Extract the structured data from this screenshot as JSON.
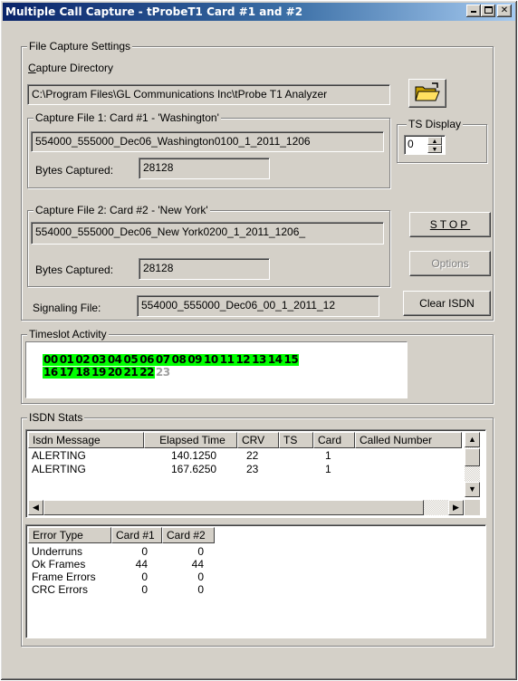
{
  "window": {
    "title": "Multiple Call Capture - tProbeT1 Card #1 and #2"
  },
  "file_capture": {
    "group_title": "File Capture Settings",
    "capture_directory_label": "Capture Directory",
    "capture_directory_value": "C:\\Program Files\\GL Communications Inc\\tProbe T1 Analyzer",
    "file1": {
      "group_title": "Capture File 1: Card #1 - 'Washington'",
      "filename": "554000_555000_Dec06_Washington0100_1_2011_1206",
      "bytes_label": "Bytes Captured:",
      "bytes_value": "28128"
    },
    "file2": {
      "group_title": "Capture File 2: Card #2 - 'New York'",
      "filename": "554000_555000_Dec06_New York0200_1_2011_1206_",
      "bytes_label": "Bytes Captured:",
      "bytes_value": "28128"
    },
    "signaling_label": "Signaling File:",
    "signaling_value": "554000_555000_Dec06_00_1_2011_12"
  },
  "ts_display": {
    "group_title": "TS Display",
    "value": "0"
  },
  "buttons": {
    "stop": "STOP",
    "options": "Options",
    "clear_isdn": "Clear ISDN"
  },
  "timeslot_activity": {
    "group_title": "Timeslot Activity",
    "active": [
      "00",
      "01",
      "02",
      "03",
      "04",
      "05",
      "06",
      "07",
      "08",
      "09",
      "10",
      "11",
      "12",
      "13",
      "14",
      "15",
      "16",
      "17",
      "18",
      "19",
      "20",
      "21",
      "22"
    ],
    "inactive": [
      "23"
    ],
    "active_color": "#00ff00"
  },
  "isdn_stats": {
    "group_title": "ISDN Stats",
    "columns": [
      "Isdn Message",
      "Elapsed Time",
      "CRV",
      "TS",
      "Card",
      "Called Number"
    ],
    "rows": [
      [
        "ALERTING",
        "140.1250",
        "22",
        "",
        "1",
        ""
      ],
      [
        "ALERTING",
        "167.6250",
        "23",
        "",
        "1",
        ""
      ]
    ]
  },
  "error_stats": {
    "columns": [
      "Error Type",
      "Card #1",
      "Card #2"
    ],
    "rows": [
      [
        "Underruns",
        "0",
        "0"
      ],
      [
        "Ok Frames",
        "44",
        "44"
      ],
      [
        "Frame Errors",
        "0",
        "0"
      ],
      [
        "CRC Errors",
        "0",
        "0"
      ]
    ]
  }
}
